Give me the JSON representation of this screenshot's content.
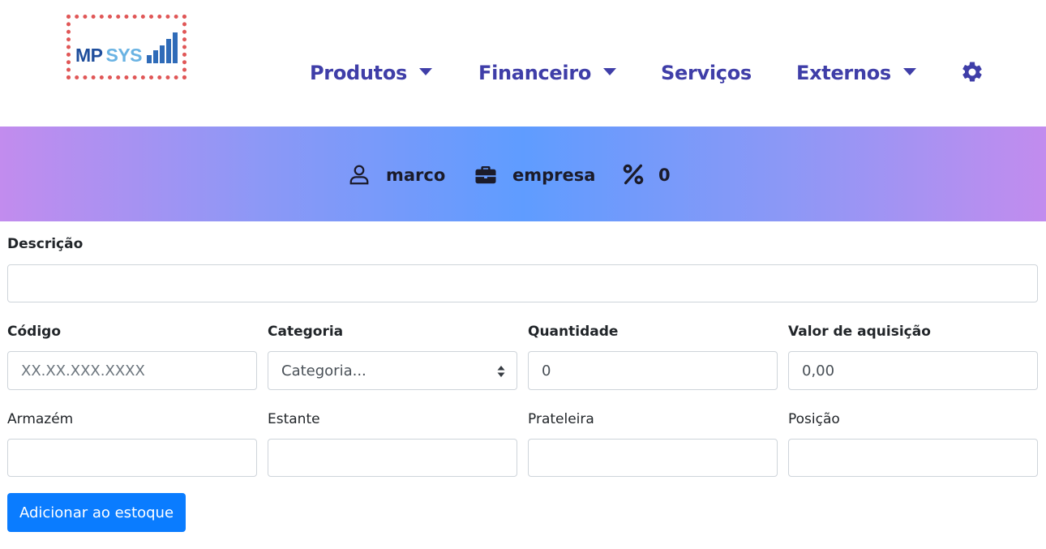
{
  "brand": {
    "part1": "MP",
    "part2": "SYS"
  },
  "nav": {
    "items": [
      {
        "label": "Produtos",
        "has_dropdown": true
      },
      {
        "label": "Financeiro",
        "has_dropdown": true
      },
      {
        "label": "Serviços",
        "has_dropdown": false
      },
      {
        "label": "Externos",
        "has_dropdown": true
      }
    ],
    "settings_icon": "gear-icon"
  },
  "banner": {
    "user": "marco",
    "company": "empresa",
    "percent": "0",
    "icons": [
      "user-icon",
      "briefcase-icon",
      "percent-icon"
    ]
  },
  "form": {
    "descricao": {
      "label": "Descrição",
      "value": "",
      "placeholder": ""
    },
    "codigo": {
      "label": "Código",
      "value": "",
      "placeholder": "XX.XX.XXX.XXXX"
    },
    "categoria": {
      "label": "Categoria",
      "selected": "Categoria..."
    },
    "quantidade": {
      "label": "Quantidade",
      "value": "0"
    },
    "valor": {
      "label": "Valor de aquisição",
      "value": "0,00"
    },
    "armazem": {
      "label": "Armazém",
      "value": ""
    },
    "estante": {
      "label": "Estante",
      "value": ""
    },
    "prateleira": {
      "label": "Prateleira",
      "value": ""
    },
    "posicao": {
      "label": "Posição",
      "value": ""
    },
    "submit_label": "Adicionar ao estoque"
  },
  "colors": {
    "nav_text": "#3f3ea8",
    "button": "#0a7cff",
    "banner_gradient": [
      "#c28cee",
      "#5f9cff",
      "#c28cee"
    ],
    "logo_border": "#e05757"
  }
}
